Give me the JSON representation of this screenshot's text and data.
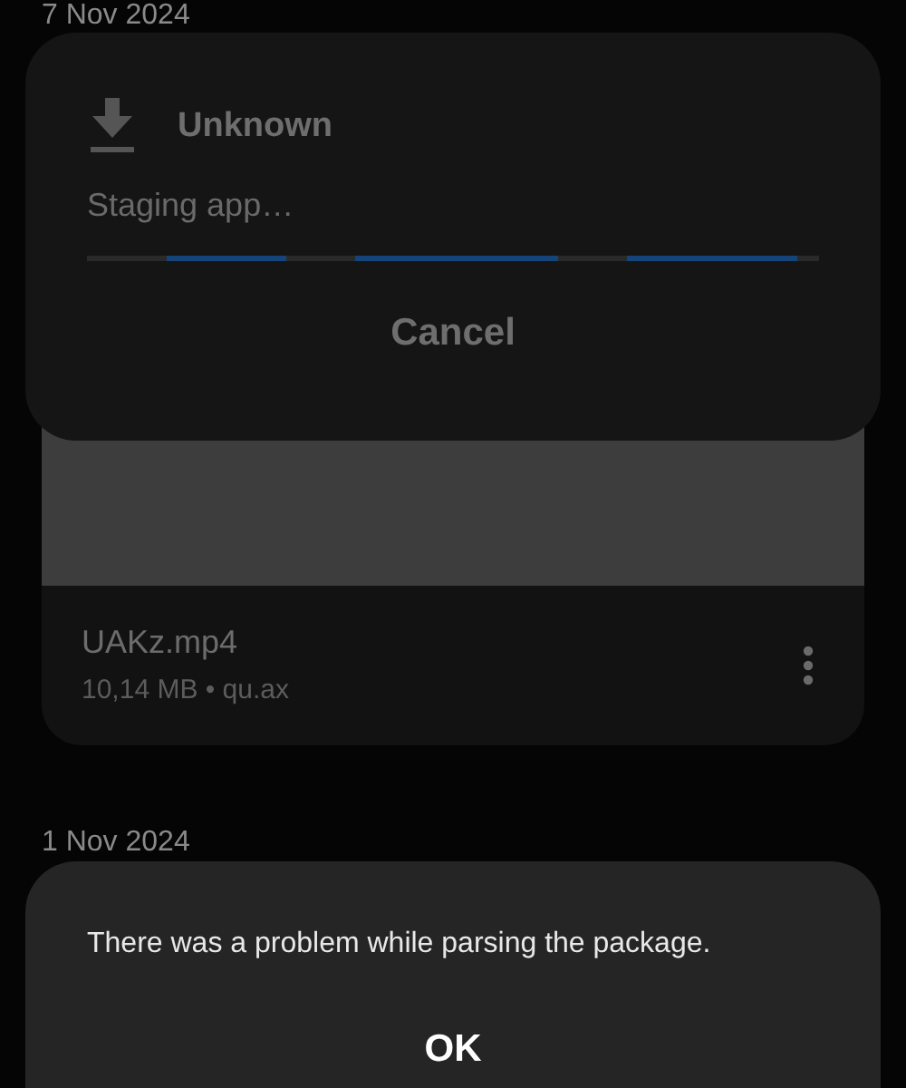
{
  "groups": [
    {
      "date": "7 Nov 2024",
      "file": {
        "name": "UAKz.mp4",
        "meta": "10,14 MB • qu.ax"
      }
    },
    {
      "date": "1 Nov 2024"
    }
  ],
  "progress_dialog": {
    "title": "Unknown",
    "status": "Staging app…",
    "indeterminate": true,
    "button": "Cancel"
  },
  "error_dialog": {
    "message": "There was a problem while parsing the package.",
    "button": "OK"
  }
}
